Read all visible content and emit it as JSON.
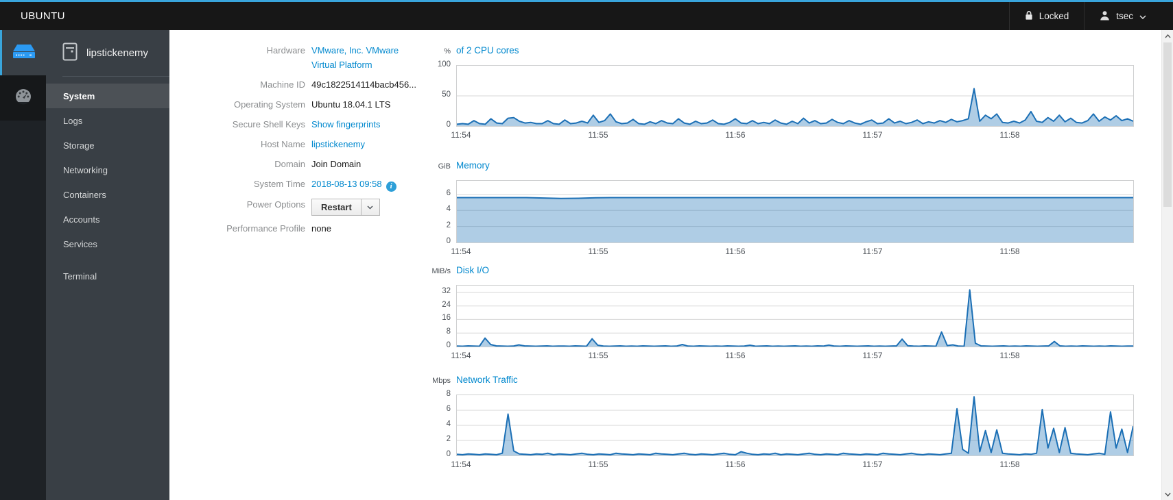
{
  "topbar": {
    "brand": "UBUNTU",
    "locked": "Locked",
    "user": "tsec"
  },
  "rail": {
    "host_icon": "server-icon",
    "dashboard_icon": "dashboard-gauge-icon"
  },
  "sidebar": {
    "host": "lipstickenemy",
    "items": [
      {
        "label": "System",
        "selected": true
      },
      {
        "label": "Logs"
      },
      {
        "label": "Storage"
      },
      {
        "label": "Networking"
      },
      {
        "label": "Containers"
      },
      {
        "label": "Accounts"
      },
      {
        "label": "Services"
      },
      {
        "label": "Terminal",
        "separated": true
      }
    ]
  },
  "details": {
    "rows": [
      {
        "label": "Hardware",
        "value": "VMware, Inc. VMware Virtual Platform",
        "kind": "wrap-link"
      },
      {
        "label": "Machine ID",
        "value": "49c1822514114bacb456...",
        "kind": "text"
      },
      {
        "label": "Operating System",
        "value": "Ubuntu 18.04.1 LTS",
        "kind": "text"
      },
      {
        "label": "Secure Shell Keys",
        "value": "Show fingerprints",
        "kind": "link"
      },
      {
        "label": "Host Name",
        "value": "lipstickenemy",
        "kind": "link"
      },
      {
        "label": "Domain",
        "value": "Join Domain",
        "kind": "text"
      },
      {
        "label": "System Time",
        "value": "2018-08-13 09:58",
        "kind": "time"
      },
      {
        "label": "Power Options",
        "value": "Restart",
        "kind": "power"
      },
      {
        "label": "Performance Profile",
        "value": "none",
        "kind": "text"
      }
    ]
  },
  "chart_data": [
    {
      "type": "area",
      "unit": "%",
      "title": "of 2 CPU cores",
      "ylim": [
        0,
        100
      ],
      "yticks": [
        0,
        50,
        100
      ],
      "grid": true,
      "legend": "none",
      "x_labels": [
        "11:54",
        "11:55",
        "11:56",
        "11:57",
        "11:58"
      ],
      "x_label_fracs": [
        0.007,
        0.21,
        0.413,
        0.616,
        0.818
      ],
      "values": [
        3,
        4,
        3,
        9,
        4,
        3,
        12,
        5,
        4,
        13,
        14,
        8,
        5,
        6,
        4,
        4,
        9,
        4,
        3,
        10,
        4,
        5,
        8,
        5,
        18,
        6,
        9,
        20,
        7,
        4,
        5,
        11,
        4,
        3,
        7,
        4,
        9,
        5,
        4,
        12,
        5,
        3,
        8,
        4,
        5,
        10,
        4,
        3,
        6,
        12,
        5,
        4,
        9,
        4,
        6,
        4,
        10,
        5,
        3,
        8,
        4,
        13,
        5,
        9,
        4,
        5,
        11,
        6,
        4,
        9,
        5,
        3,
        7,
        10,
        4,
        5,
        12,
        5,
        8,
        4,
        6,
        10,
        4,
        7,
        5,
        9,
        6,
        11,
        7,
        9,
        12,
        62,
        8,
        18,
        12,
        20,
        6,
        5,
        8,
        5,
        10,
        24,
        8,
        6,
        14,
        8,
        18,
        7,
        13,
        6,
        5,
        9,
        20,
        8,
        15,
        10,
        17,
        9,
        12,
        8
      ]
    },
    {
      "type": "area",
      "unit": "GiB",
      "title": "Memory",
      "ylim": [
        0,
        7.7
      ],
      "yticks": [
        0,
        2,
        4,
        6
      ],
      "grid": true,
      "legend": "none",
      "x_labels": [
        "11:54",
        "11:55",
        "11:56",
        "11:57",
        "11:58"
      ],
      "x_label_fracs": [
        0.007,
        0.21,
        0.413,
        0.616,
        0.818
      ],
      "values": [
        5.6,
        5.6,
        5.6,
        5.6,
        5.6,
        5.55,
        5.5,
        5.52,
        5.58,
        5.6,
        5.6,
        5.6,
        5.6,
        5.6,
        5.6,
        5.6,
        5.6,
        5.6,
        5.6,
        5.6,
        5.6,
        5.6,
        5.6,
        5.6,
        5.6,
        5.6,
        5.6,
        5.6,
        5.6,
        5.6,
        5.6,
        5.6,
        5.6,
        5.6,
        5.6,
        5.6,
        5.6,
        5.6,
        5.6,
        5.6
      ]
    },
    {
      "type": "area",
      "unit": "MiB/s",
      "title": "Disk I/O",
      "ylim": [
        0,
        36
      ],
      "yticks": [
        0,
        8,
        16,
        24,
        32
      ],
      "grid": true,
      "legend": "none",
      "x_labels": [
        "11:54",
        "11:55",
        "11:56",
        "11:57",
        "11:58"
      ],
      "x_label_fracs": [
        0.007,
        0.21,
        0.413,
        0.616,
        0.818
      ],
      "values": [
        0.3,
        0.2,
        0.4,
        0.3,
        0.2,
        5,
        1.2,
        0.4,
        0.3,
        0.2,
        0.3,
        1,
        0.4,
        0.3,
        0.2,
        0.3,
        0.4,
        0.2,
        0.3,
        0.3,
        0.2,
        0.4,
        0.3,
        0.2,
        4.6,
        0.8,
        0.3,
        0.2,
        0.3,
        0.4,
        0.2,
        0.3,
        0.2,
        0.4,
        0.3,
        0.2,
        0.3,
        0.4,
        0.2,
        0.3,
        1.2,
        0.3,
        0.2,
        0.4,
        0.3,
        0.2,
        0.3,
        0.2,
        0.4,
        0.3,
        0.2,
        0.3,
        0.8,
        0.2,
        0.3,
        0.4,
        0.2,
        0.3,
        0.2,
        0.3,
        0.4,
        0.2,
        0.3,
        0.2,
        0.4,
        0.3,
        0.9,
        0.3,
        0.2,
        0.4,
        0.3,
        0.2,
        0.3,
        0.4,
        0.2,
        0.3,
        0.2,
        0.3,
        0.4,
        4.4,
        0.5,
        0.3,
        0.2,
        0.4,
        0.3,
        0.2,
        8.6,
        0.6,
        1,
        0.3,
        0.2,
        33.5,
        2,
        0.4,
        0.3,
        0.2,
        0.3,
        0.4,
        0.2,
        0.3,
        0.2,
        0.4,
        0.3,
        0.2,
        0.3,
        0.4,
        3,
        0.4,
        0.2,
        0.3,
        0.2,
        0.4,
        0.3,
        0.2,
        0.3,
        0.2,
        0.4,
        0.3,
        0.2,
        0.3,
        0.3
      ]
    },
    {
      "type": "area",
      "unit": "Mbps",
      "title": "Network Traffic",
      "ylim": [
        0,
        8
      ],
      "yticks": [
        0,
        2,
        4,
        6,
        8
      ],
      "grid": true,
      "legend": "none",
      "x_labels": [
        "11:54",
        "11:55",
        "11:56",
        "11:57",
        "11:58"
      ],
      "x_label_fracs": [
        0.007,
        0.21,
        0.413,
        0.616,
        0.818
      ],
      "values": [
        0.15,
        0.1,
        0.2,
        0.15,
        0.1,
        0.2,
        0.15,
        0.1,
        0.3,
        5.5,
        0.6,
        0.2,
        0.15,
        0.1,
        0.2,
        0.15,
        0.3,
        0.1,
        0.2,
        0.15,
        0.1,
        0.2,
        0.3,
        0.15,
        0.1,
        0.2,
        0.15,
        0.1,
        0.3,
        0.2,
        0.15,
        0.1,
        0.2,
        0.15,
        0.1,
        0.3,
        0.2,
        0.15,
        0.1,
        0.2,
        0.3,
        0.15,
        0.1,
        0.2,
        0.15,
        0.1,
        0.2,
        0.3,
        0.15,
        0.1,
        0.5,
        0.3,
        0.15,
        0.1,
        0.2,
        0.15,
        0.3,
        0.1,
        0.2,
        0.15,
        0.1,
        0.2,
        0.3,
        0.15,
        0.1,
        0.2,
        0.15,
        0.1,
        0.3,
        0.2,
        0.15,
        0.1,
        0.2,
        0.15,
        0.1,
        0.3,
        0.2,
        0.15,
        0.1,
        0.2,
        0.3,
        0.15,
        0.1,
        0.2,
        0.15,
        0.1,
        0.2,
        0.3,
        6.2,
        0.8,
        0.3,
        7.8,
        0.5,
        3.3,
        0.4,
        3.4,
        0.3,
        0.2,
        0.15,
        0.1,
        0.2,
        0.15,
        0.3,
        6.1,
        1,
        3.6,
        0.4,
        3.7,
        0.3,
        0.2,
        0.15,
        0.1,
        0.2,
        0.3,
        0.15,
        5.8,
        1,
        3.5,
        0.4,
        3.9
      ]
    }
  ],
  "colors": {
    "accent": "#39a5dc",
    "link": "#0088ce",
    "chart_line": "#1b6fb5",
    "chart_fill": "rgba(27,111,181,0.35)",
    "topbar_bg": "#171717",
    "sidebar_bg": "#393f45",
    "sidebar_selected": "#4c5156"
  }
}
